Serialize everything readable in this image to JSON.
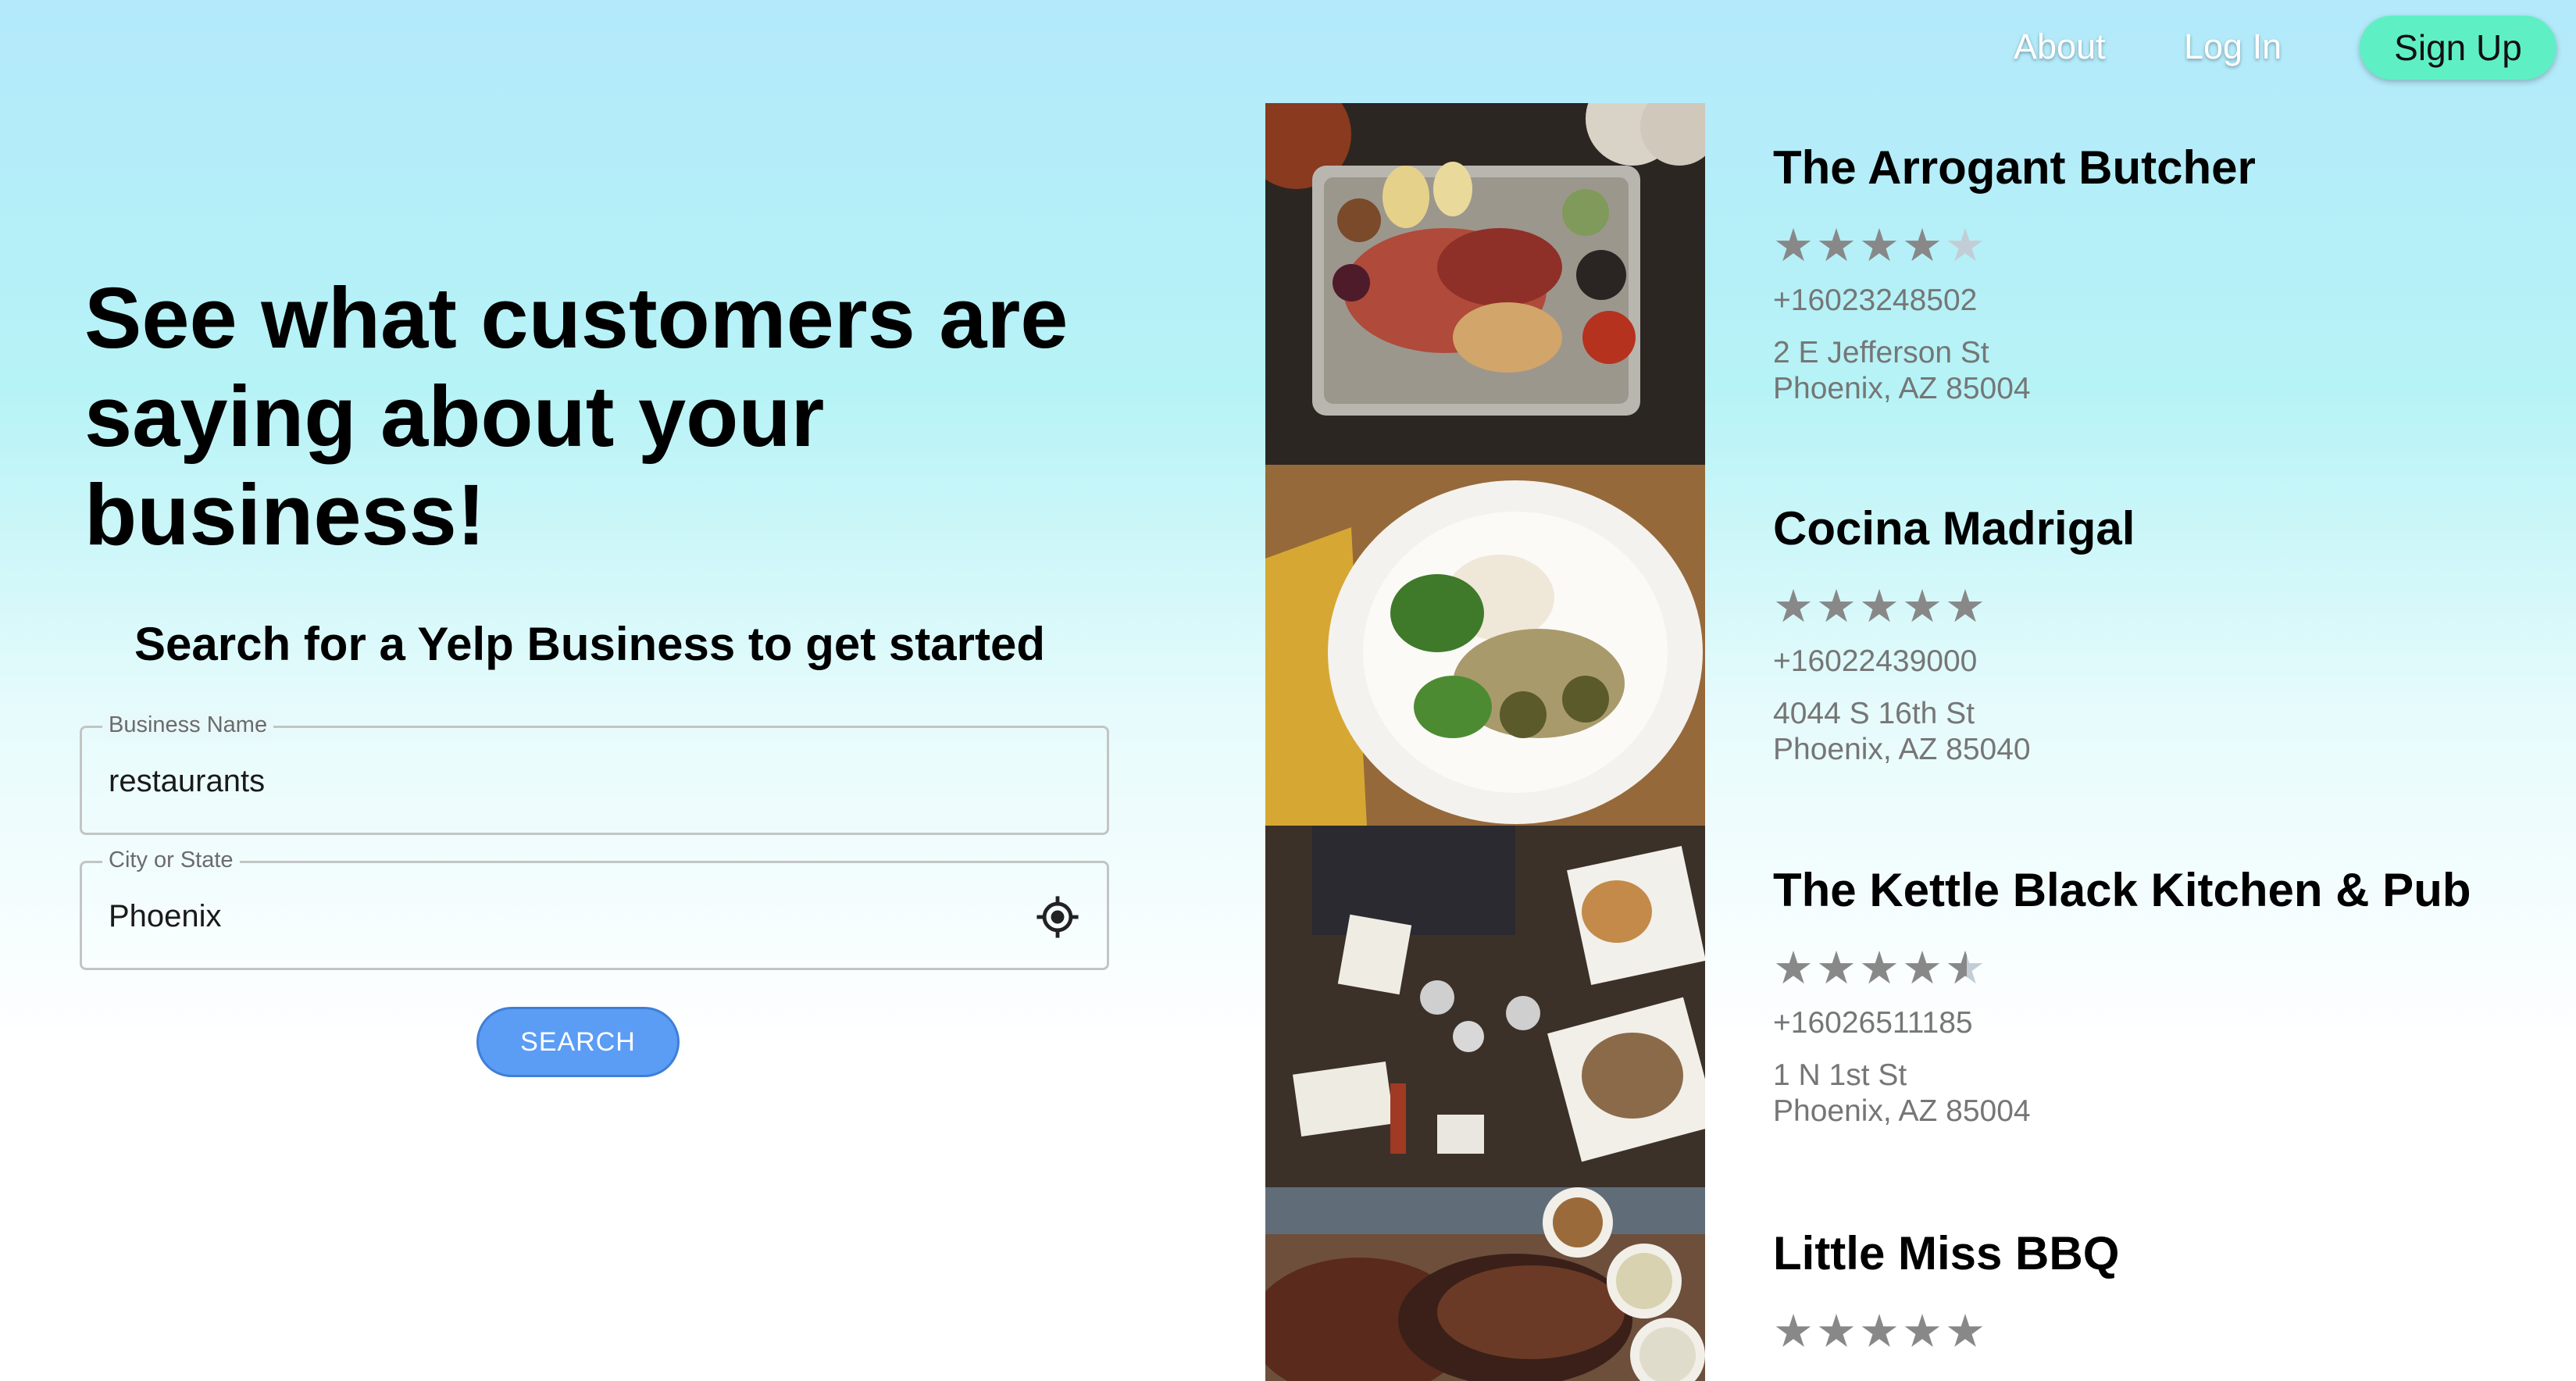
{
  "nav": {
    "about": "About",
    "login": "Log In",
    "signup": "Sign Up"
  },
  "hero": {
    "title": "See what customers are saying about your business!",
    "subtitle": "Search for a Yelp Business to get started"
  },
  "search": {
    "name_label": "Business Name",
    "name_value": "restaurants",
    "city_label": "City or State",
    "city_value": "Phoenix",
    "button": "SEARCH"
  },
  "results": [
    {
      "name": "The Arrogant Butcher",
      "rating": 4,
      "phone": "+16023248502",
      "address_line1": "2 E Jefferson St",
      "address_line2": "Phoenix, AZ 85004"
    },
    {
      "name": "Cocina Madrigal",
      "rating": 5,
      "phone": "+16022439000",
      "address_line1": "4044 S 16th St",
      "address_line2": "Phoenix, AZ 85040"
    },
    {
      "name": "The Kettle Black Kitchen & Pub",
      "rating": 4.5,
      "phone": "+16026511185",
      "address_line1": "1 N 1st St",
      "address_line2": "Phoenix, AZ 85004"
    },
    {
      "name": "Little Miss BBQ",
      "rating": 5
    }
  ],
  "colors": {
    "signup_bg": "#5ef0c4",
    "search_button": "#5b9df5",
    "star_filled": "#888888",
    "star_empty": "#c3cdd6"
  }
}
